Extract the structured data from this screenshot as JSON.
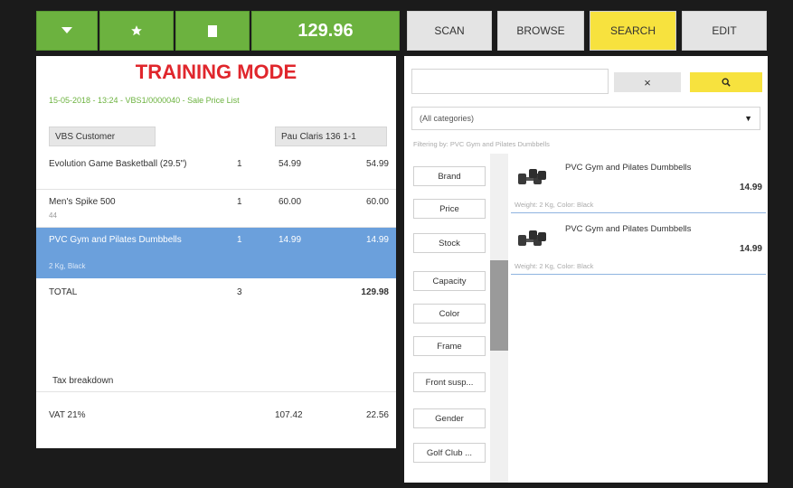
{
  "toolbar": {
    "total": "129.96"
  },
  "tabs": [
    {
      "label": "SCAN",
      "active": false
    },
    {
      "label": "BROWSE",
      "active": false
    },
    {
      "label": "SEARCH",
      "active": true
    },
    {
      "label": "EDIT",
      "active": false
    }
  ],
  "ticket": {
    "training_mode": "TRAINING MODE",
    "meta": "15-05-2018 - 13:24 - VBS1/0000040 - Sale Price List",
    "customer": "VBS Customer",
    "price_list": "Pau Claris 136 1-1",
    "lines": [
      {
        "name": "Evolution Game Basketball (29.5\")",
        "sub": "",
        "qty": "1",
        "price": "54.99",
        "amount": "54.99"
      },
      {
        "name": "Men's Spike 500",
        "sub": "44",
        "qty": "1",
        "price": "60.00",
        "amount": "60.00"
      },
      {
        "name": "PVC Gym and Pilates Dumbbells",
        "sub": "2 Kg, Black",
        "qty": "1",
        "price": "14.99",
        "amount": "14.99"
      }
    ],
    "total_label": "TOTAL",
    "total_qty": "3",
    "total_amount": "129.98",
    "tax_label": "Tax breakdown",
    "tax_name": "VAT 21%",
    "tax_base": "107.42",
    "tax_amount": "22.56"
  },
  "search": {
    "query": "",
    "clear_label": "×",
    "category": "(All categories)",
    "filter_note": "Filtering by: PVC Gym and Pilates Dumbbells",
    "filters": [
      "Brand",
      "Price",
      "Stock",
      "Capacity",
      "Color",
      "Frame",
      "Front susp...",
      "Gender",
      "Golf Club ..."
    ],
    "products": [
      {
        "name": "PVC Gym and Pilates Dumbbells",
        "price": "14.99",
        "desc": "Weight: 2 Kg, Color: Black"
      },
      {
        "name": "PVC Gym and Pilates Dumbbells",
        "price": "14.99",
        "desc": "Weight: 2 Kg, Color: Black"
      }
    ]
  },
  "colors": {
    "green": "#6cb23f",
    "yellow": "#f7e23e",
    "selected_blue": "#6ba0dc",
    "training_red": "#e0262c"
  },
  "icons": [
    "dropdown-icon",
    "star-icon",
    "document-icon",
    "close-icon",
    "search-icon",
    "chevron-down-icon",
    "dumbbell-icon"
  ]
}
